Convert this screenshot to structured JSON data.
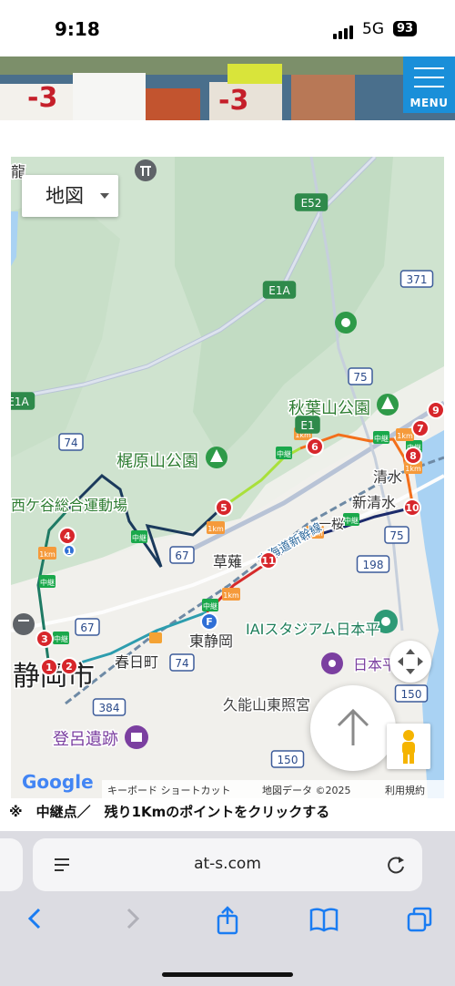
{
  "status_bar": {
    "time": "9:18",
    "network": "5G",
    "battery": "93"
  },
  "header": {
    "menu_label": "MENU"
  },
  "map": {
    "map_type_label": "地図",
    "place_labels": [
      {
        "text": "梶原山公園",
        "color": "#2e7d32"
      },
      {
        "text": "秋葉山公園",
        "color": "#2e7d32"
      },
      {
        "text": "静岡市",
        "color": "#222222"
      },
      {
        "text": "東静岡",
        "color": "#333333"
      },
      {
        "text": "春日町",
        "color": "#333333"
      },
      {
        "text": "草薙",
        "color": "#333333"
      },
      {
        "text": "清水",
        "color": "#333333"
      },
      {
        "text": "新清水",
        "color": "#333333"
      },
      {
        "text": "一桜",
        "color": "#333333"
      },
      {
        "text": "登呂遺跡",
        "color": "#7b3fa0"
      },
      {
        "text": "久能山東照宮",
        "color": "#444444"
      },
      {
        "text": "IAIスタジアム日本平",
        "color": "#1e7e5a"
      },
      {
        "text": "西ケ谷総合運動場",
        "color": "#2e7d32"
      },
      {
        "text": "龍",
        "color": "#333333"
      },
      {
        "text": "日本平",
        "color": "#7b3fa0"
      },
      {
        "text": "東海道新幹線",
        "color": "#2e6a9e"
      }
    ],
    "road_shields": [
      "E52",
      "E1A",
      "E1A",
      "E1",
      "371",
      "75",
      "74",
      "67",
      "74",
      "384",
      "150",
      "150",
      "198",
      "75",
      "67"
    ],
    "route_markers": [
      "1",
      "2",
      "3",
      "4",
      "5",
      "6",
      "7",
      "8",
      "9",
      "10",
      "11",
      "1",
      "F"
    ],
    "relay_badge_text": "中継",
    "km_badge_text": "1km",
    "google_logo": "Google",
    "footer": {
      "shortcuts": "キーボード ショートカット",
      "map_data": "地図データ ©2025",
      "terms": "利用規約"
    }
  },
  "note": "※　中継点／　残り1Kmのポイントをクリックする",
  "browser": {
    "url": "at-s.com"
  }
}
